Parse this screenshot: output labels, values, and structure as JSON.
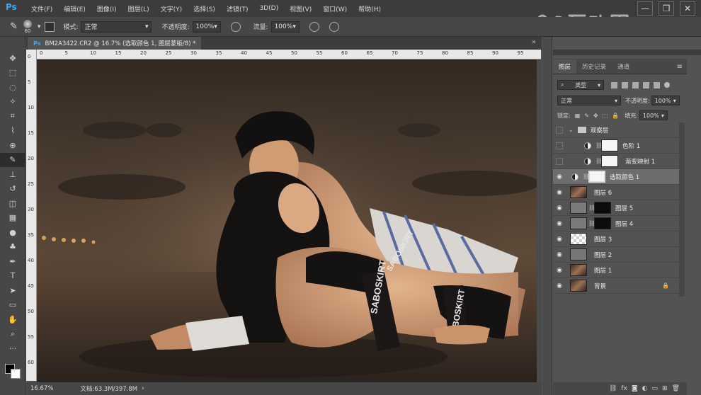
{
  "app": {
    "logo": "Ps"
  },
  "menu": [
    "文件(F)",
    "编辑(E)",
    "图像(I)",
    "图层(L)",
    "文字(Y)",
    "选择(S)",
    "滤镜(T)",
    "3D(D)",
    "视图(V)",
    "窗口(W)",
    "帮助(H)"
  ],
  "options": {
    "brush_size": "60",
    "mode_label": "模式:",
    "mode_value": "正常",
    "opacity_label": "不透明度:",
    "opacity_value": "100%",
    "flow_label": "流量:",
    "flow_value": "100%"
  },
  "document": {
    "tab_title": "BM2A3422.CR2 @ 16.7% (选取颜色 1, 图层蒙版/8) *",
    "zoom": "16.67%",
    "doc_size": "文档:63.3M/397.8M"
  },
  "ruler_h_labels": [
    "0",
    "5",
    "10",
    "15",
    "20",
    "25",
    "30",
    "35",
    "40",
    "45",
    "50",
    "55",
    "60",
    "65",
    "70",
    "75",
    "80",
    "85",
    "90",
    "95"
  ],
  "ruler_v_labels": [
    "0",
    "5",
    "10",
    "15",
    "20",
    "25",
    "30",
    "35",
    "40",
    "45",
    "50",
    "55",
    "60"
  ],
  "canvas_text": {
    "shorts_print": "SABOSKIRT",
    "band_print": "SABOSKIRT",
    "band_print2": "SABOSKIRT"
  },
  "panel": {
    "tabs": [
      "图层",
      "历史记录",
      "通道"
    ],
    "filter_label": "类型",
    "blend_mode": "正常",
    "opacity_label": "不透明度:",
    "opacity_value": "100%",
    "lock_label": "锁定:",
    "fill_label": "填充:",
    "fill_value": "100%"
  },
  "layers": [
    {
      "name": "观察层",
      "type": "group",
      "visible": false
    },
    {
      "name": "色阶 1",
      "type": "adjustment",
      "visible": false,
      "indent": true
    },
    {
      "name": "渐变映射 1",
      "type": "adjustment",
      "visible": false,
      "indent": true
    },
    {
      "name": "选取颜色 1",
      "type": "adjustment",
      "visible": true,
      "selected": true
    },
    {
      "name": "图层 6",
      "type": "photo",
      "visible": true
    },
    {
      "name": "图层 5",
      "type": "masked",
      "visible": true
    },
    {
      "name": "图层 4",
      "type": "masked",
      "visible": true
    },
    {
      "name": "图层 3",
      "type": "transparent",
      "visible": true
    },
    {
      "name": "图层 2",
      "type": "gray",
      "visible": true
    },
    {
      "name": "图层 1",
      "type": "photo",
      "visible": true
    },
    {
      "name": "背景",
      "type": "photo",
      "visible": true,
      "locked": true
    }
  ],
  "colors": {
    "accent": "#31a8ff",
    "fg": "#000000",
    "bg": "#ffffff"
  }
}
